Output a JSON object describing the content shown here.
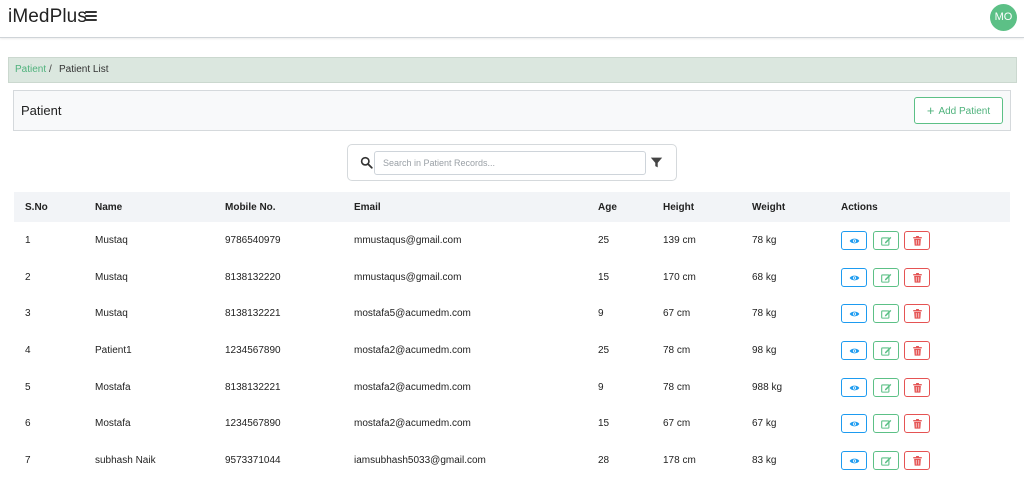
{
  "app": {
    "brand": "iMedPlus",
    "avatar_initials": "MO"
  },
  "breadcrumb": {
    "link": "Patient",
    "separator": "/",
    "current": "Patient List"
  },
  "card": {
    "title": "Patient",
    "add_button": "Add Patient"
  },
  "search": {
    "placeholder": "Search in Patient Records..."
  },
  "table": {
    "headers": {
      "sno": "S.No",
      "name": "Name",
      "mobile": "Mobile No.",
      "email": "Email",
      "age": "Age",
      "height": "Height",
      "weight": "Weight",
      "actions": "Actions"
    },
    "rows": [
      {
        "sno": "1",
        "name": "Mustaq",
        "mobile": "9786540979",
        "email": "mmustaqus@gmail.com",
        "age": "25",
        "height": "139 cm",
        "weight": "78 kg"
      },
      {
        "sno": "2",
        "name": "Mustaq",
        "mobile": "8138132220",
        "email": "mmustaqus@gmail.com",
        "age": "15",
        "height": "170 cm",
        "weight": "68 kg"
      },
      {
        "sno": "3",
        "name": "Mustaq",
        "mobile": "8138132221",
        "email": "mostafa5@acumedm.com",
        "age": "9",
        "height": "67 cm",
        "weight": "78 kg"
      },
      {
        "sno": "4",
        "name": "Patient1",
        "mobile": "1234567890",
        "email": "mostafa2@acumedm.com",
        "age": "25",
        "height": "78 cm",
        "weight": "98 kg"
      },
      {
        "sno": "5",
        "name": "Mostafa",
        "mobile": "8138132221",
        "email": "mostafa2@acumedm.com",
        "age": "9",
        "height": "78 cm",
        "weight": "988 kg"
      },
      {
        "sno": "6",
        "name": "Mostafa",
        "mobile": "1234567890",
        "email": "mostafa2@acumedm.com",
        "age": "15",
        "height": "67 cm",
        "weight": "67 kg"
      },
      {
        "sno": "7",
        "name": "subhash Naik",
        "mobile": "9573371044",
        "email": "iamsubhash5033@gmail.com",
        "age": "28",
        "height": "178 cm",
        "weight": "83 kg"
      }
    ]
  },
  "colors": {
    "accent_green": "#5cc086",
    "view_blue": "#1d9bf0",
    "delete_red": "#e55353",
    "breadcrumb_bg": "#dbe7df"
  },
  "icons": {
    "menu": "hamburger-icon",
    "search": "search-icon",
    "filter": "filter-icon",
    "view": "eye-icon",
    "edit": "edit-icon",
    "delete": "trash-icon",
    "add": "plus-icon"
  }
}
